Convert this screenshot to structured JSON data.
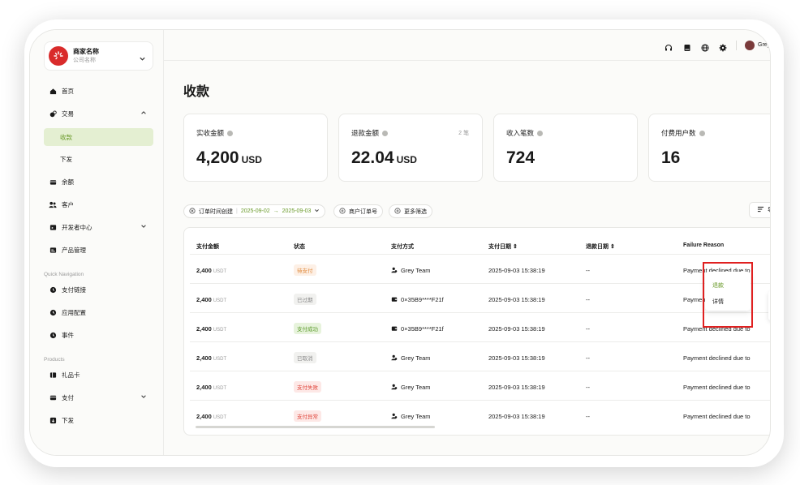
{
  "merchant": {
    "name": "商家名称",
    "company": "公司名称"
  },
  "sidebar": {
    "items": [
      {
        "label": "首页"
      },
      {
        "label": "交易"
      },
      {
        "label": "收款"
      },
      {
        "label": "下发"
      },
      {
        "label": "余额"
      },
      {
        "label": "客户"
      },
      {
        "label": "开发者中心"
      },
      {
        "label": "产品管理"
      }
    ],
    "quick_nav_title": "Quick Navigation",
    "quick_nav": [
      {
        "label": "支付链接"
      },
      {
        "label": "应用配置"
      },
      {
        "label": "事件"
      }
    ],
    "products_title": "Products",
    "products": [
      {
        "label": "礼品卡"
      },
      {
        "label": "支付"
      },
      {
        "label": "下发"
      }
    ]
  },
  "topbar": {
    "user_name": "Grey"
  },
  "page": {
    "title": "收款"
  },
  "stats": [
    {
      "label": "实收金额",
      "value": "4,200",
      "unit": "USD",
      "note": ""
    },
    {
      "label": "退款金额",
      "value": "22.04",
      "unit": "USD",
      "note": "2 笔"
    },
    {
      "label": "收入笔数",
      "value": "724",
      "unit": "",
      "note": ""
    },
    {
      "label": "付费用户数",
      "value": "16",
      "unit": "",
      "note": ""
    }
  ],
  "filters": {
    "date_label": "订单时间创建",
    "date_start": "2025-09-02",
    "date_arrow": "→",
    "date_end": "2025-09-03",
    "merchant_order": "商户订单号",
    "more": "更多筛选",
    "right_button": "导"
  },
  "table": {
    "headers": [
      "支付金额",
      "状态",
      "支付方式",
      "支付日期",
      "退款日期",
      "Failure Reason"
    ],
    "rows": [
      {
        "amount": "2,400",
        "currency": "USDT",
        "status": "待支付",
        "method": "Grey Team",
        "method_type": "user",
        "date": "2025-09-03 15:38:19",
        "refund": "--",
        "reason": "Payment declined due to"
      },
      {
        "amount": "2,400",
        "currency": "USDT",
        "status": "已过期",
        "method": "0×35B9****F21f",
        "method_type": "wallet",
        "date": "2025-09-03 15:38:19",
        "refund": "--",
        "reason": "Paymen"
      },
      {
        "amount": "2,400",
        "currency": "USDT",
        "status": "支付成功",
        "method": "0×35B9****F21f",
        "method_type": "wallet",
        "date": "2025-09-03 15:38:19",
        "refund": "--",
        "reason": "Payment declined due to"
      },
      {
        "amount": "2,400",
        "currency": "USDT",
        "status": "已取消",
        "method": "Grey Team",
        "method_type": "user",
        "date": "2025-09-03 15:38:19",
        "refund": "--",
        "reason": "Payment declined due to"
      },
      {
        "amount": "2,400",
        "currency": "USDT",
        "status": "支付失败",
        "method": "Grey Team",
        "method_type": "user",
        "date": "2025-09-03 15:38:19",
        "refund": "--",
        "reason": "Payment declined due to"
      },
      {
        "amount": "2,400",
        "currency": "USDT",
        "status": "支付异常",
        "method": "Grey Team",
        "method_type": "user",
        "date": "2025-09-03 15:38:19",
        "refund": "--",
        "reason": "Payment declined due to"
      }
    ]
  },
  "row_menu": {
    "items": [
      "退款",
      "详情"
    ]
  },
  "colors": {
    "accent_green": "#6a9a2a",
    "active_nav_bg": "#e4efd2",
    "status_pending": {
      "bg": "#fdf0e6",
      "fg": "#e08a3c"
    },
    "status_expired": {
      "bg": "#f1f1ef",
      "fg": "#8a8a8a"
    },
    "status_success": {
      "bg": "#e7f3dc",
      "fg": "#5a9a2a"
    },
    "status_cancelled": {
      "bg": "#f1f1ef",
      "fg": "#8a8a8a"
    },
    "status_failed": {
      "bg": "#fde8e6",
      "fg": "#e0463c"
    },
    "status_error": {
      "bg": "#fde8e6",
      "fg": "#e0463c"
    },
    "highlight_border": "#e02020"
  }
}
